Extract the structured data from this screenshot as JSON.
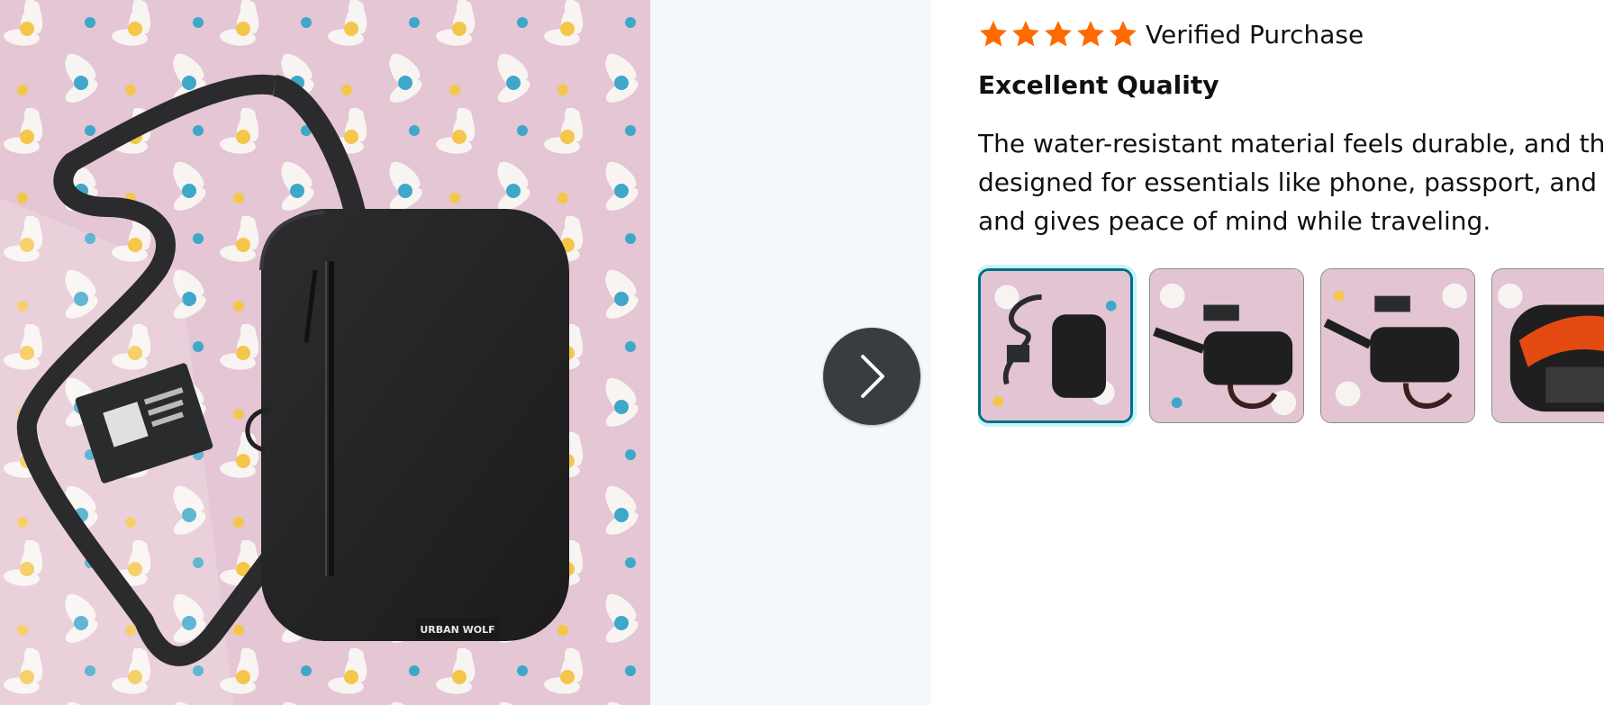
{
  "photo": {
    "brand_tag": "URBAN WOLF"
  },
  "carousel": {
    "next_icon": "chevron-right-icon"
  },
  "review": {
    "stars": 5,
    "stars_max": 5,
    "star_color": "#ff6a00",
    "verified_label": "Verified Purchase",
    "title": "Excellent Quality",
    "body_lines": [
      "The water-resistant material feels durable, and the",
      "designed for essentials like phone, passport, and w",
      "and gives peace of mind while traveling."
    ],
    "selected_thumb_border": "#007185",
    "thumbnails": [
      {
        "label": "thumbnail-1",
        "selected": true
      },
      {
        "label": "thumbnail-2",
        "selected": false
      },
      {
        "label": "thumbnail-3",
        "selected": false
      },
      {
        "label": "thumbnail-4",
        "selected": false
      }
    ]
  }
}
